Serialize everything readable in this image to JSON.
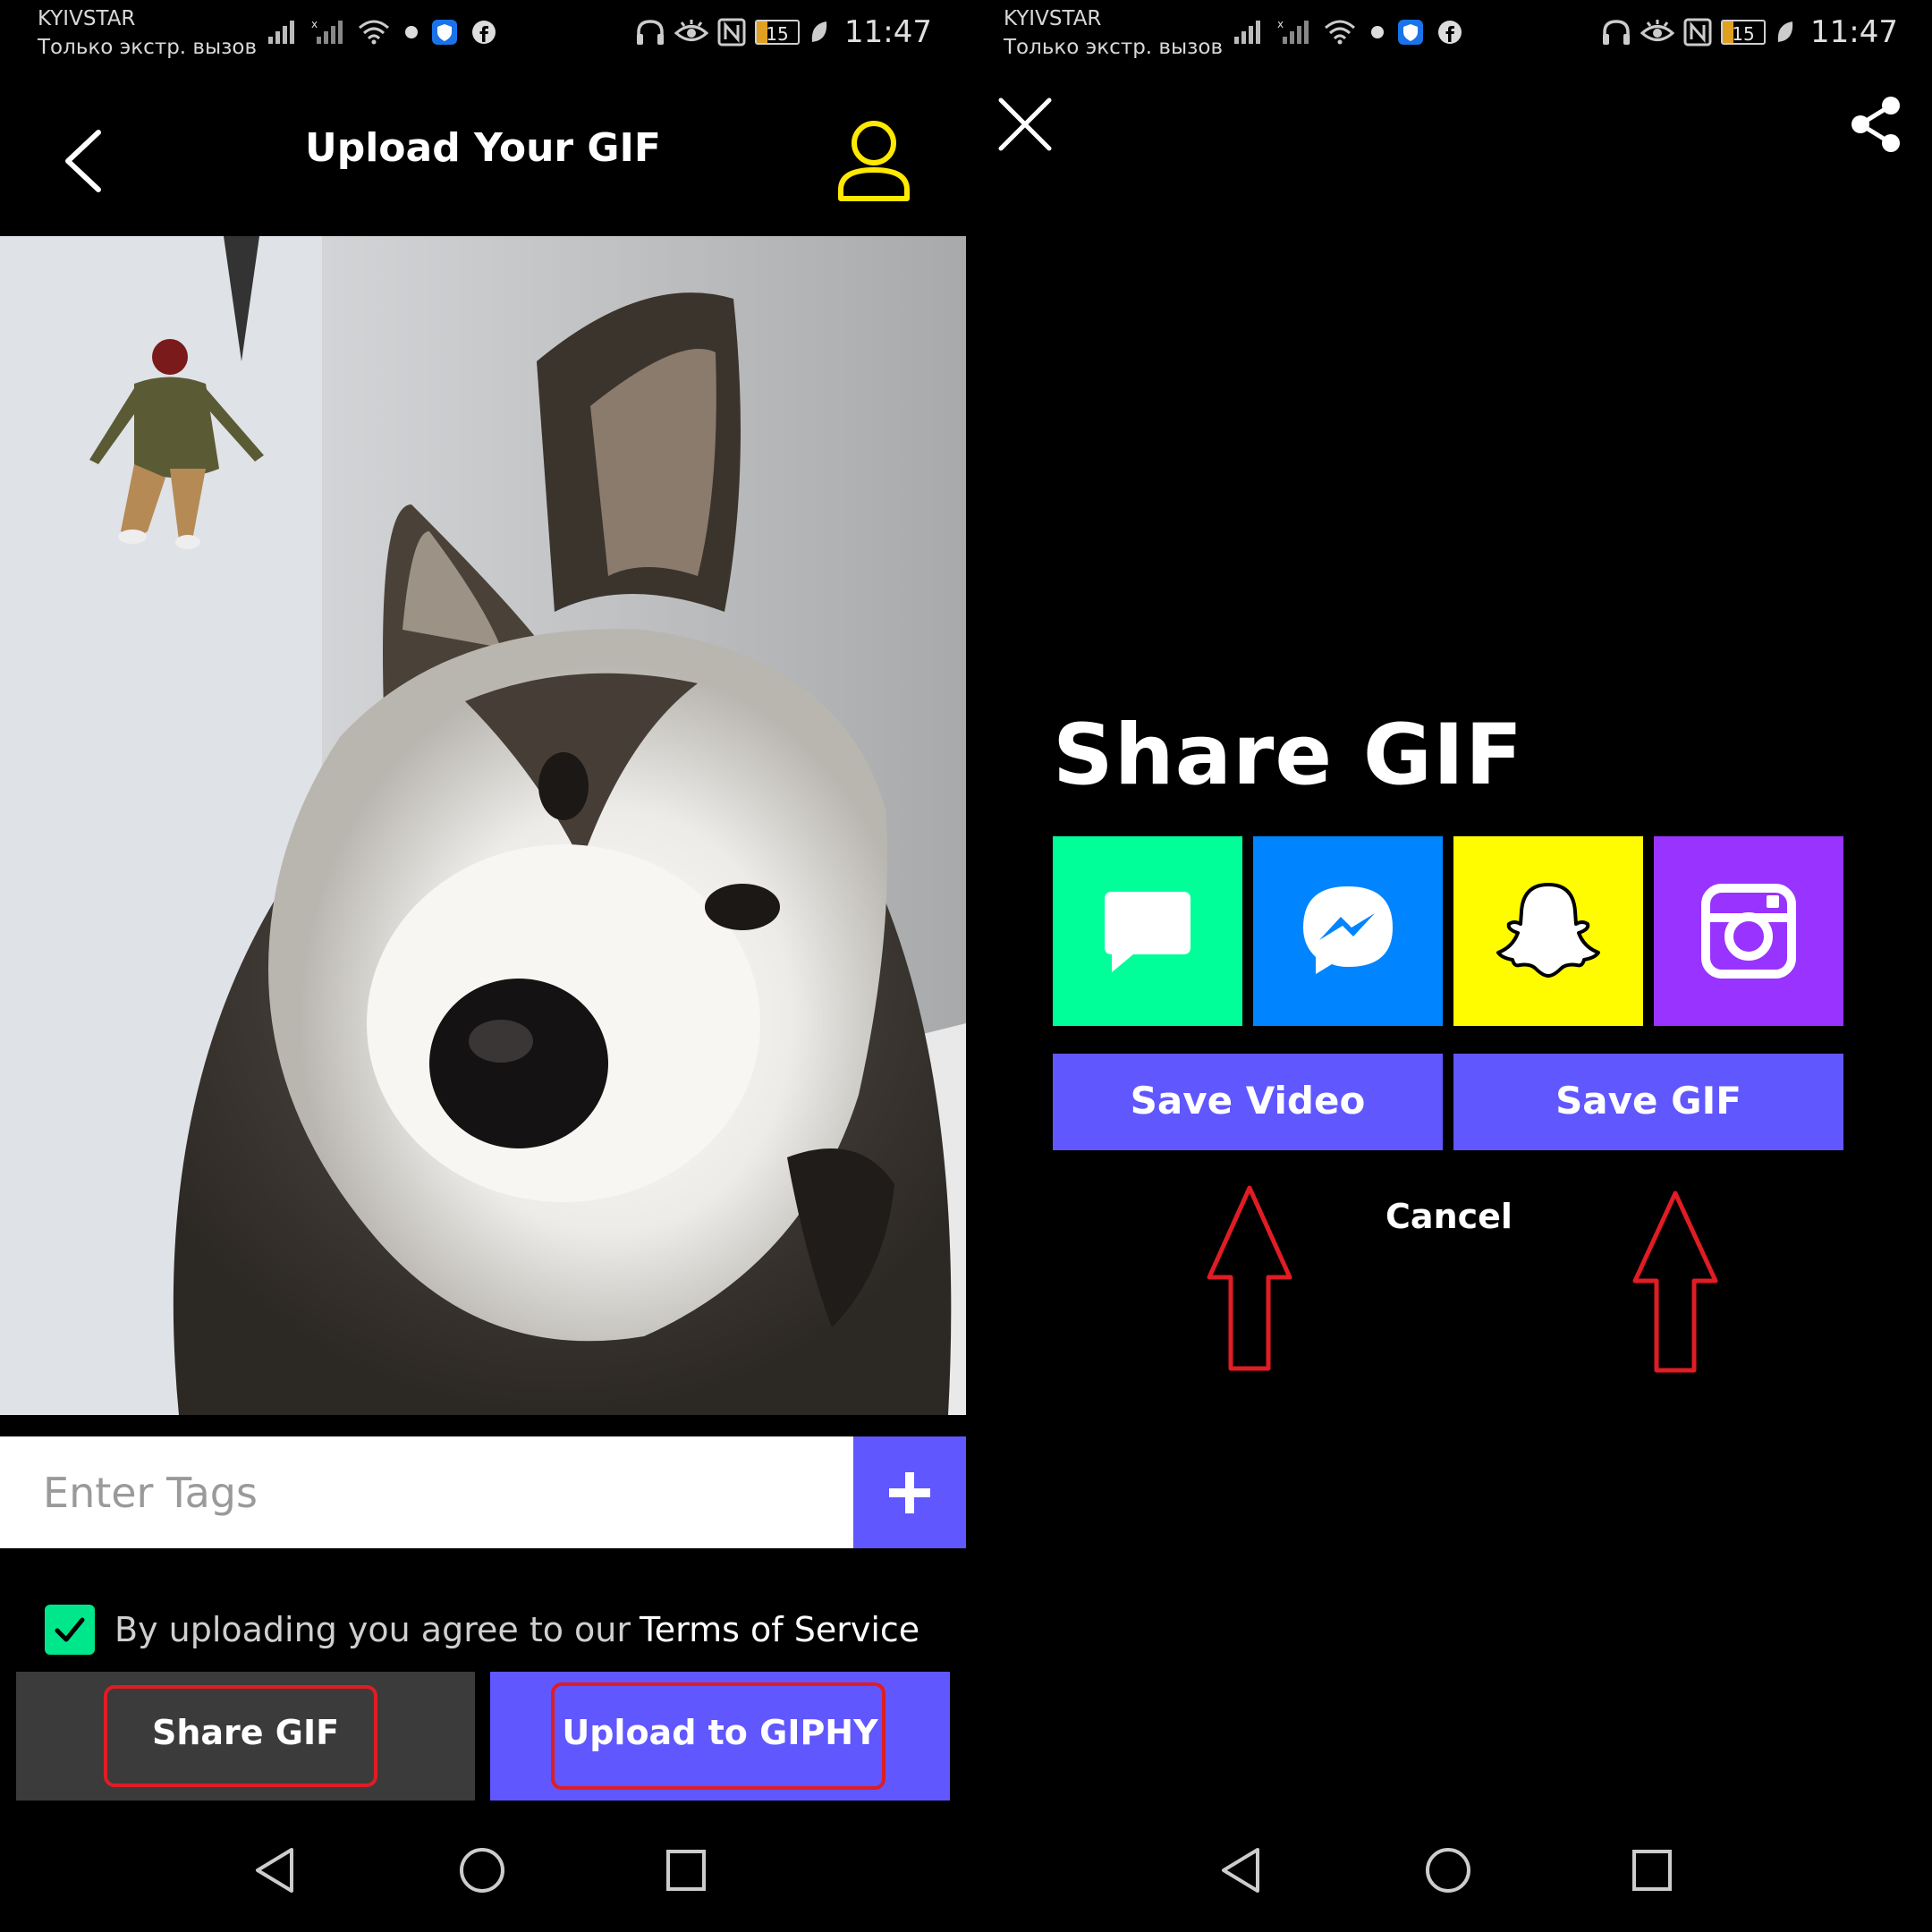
{
  "status_bar": {
    "carrier": "KYIVSTAR",
    "call_status": "Только экстр. вызов",
    "battery": "15",
    "time": "11:47"
  },
  "upload_screen": {
    "title": "Upload Your GIF",
    "tags_placeholder": "Enter Tags",
    "add_tag_symbol": "+",
    "terms_text": "By uploading you agree to our",
    "terms_link": "Terms of Service",
    "terms_checked": true,
    "share_button": "Share GIF",
    "upload_button": "Upload to GIPHY"
  },
  "share_screen": {
    "heading": "Share GIF",
    "share_targets": [
      "Messages",
      "Messenger",
      "Snapchat",
      "Instagram"
    ],
    "save_video": "Save Video",
    "save_gif": "Save GIF",
    "cancel": "Cancel"
  },
  "colors": {
    "accent": "#6157ff",
    "messages": "#00ff99",
    "messenger": "#0084ff",
    "snapchat": "#fffc00",
    "instagram": "#9933ff",
    "checkbox": "#00e68a",
    "profile_icon": "#ffe900",
    "annotation_red": "#e01c24"
  }
}
